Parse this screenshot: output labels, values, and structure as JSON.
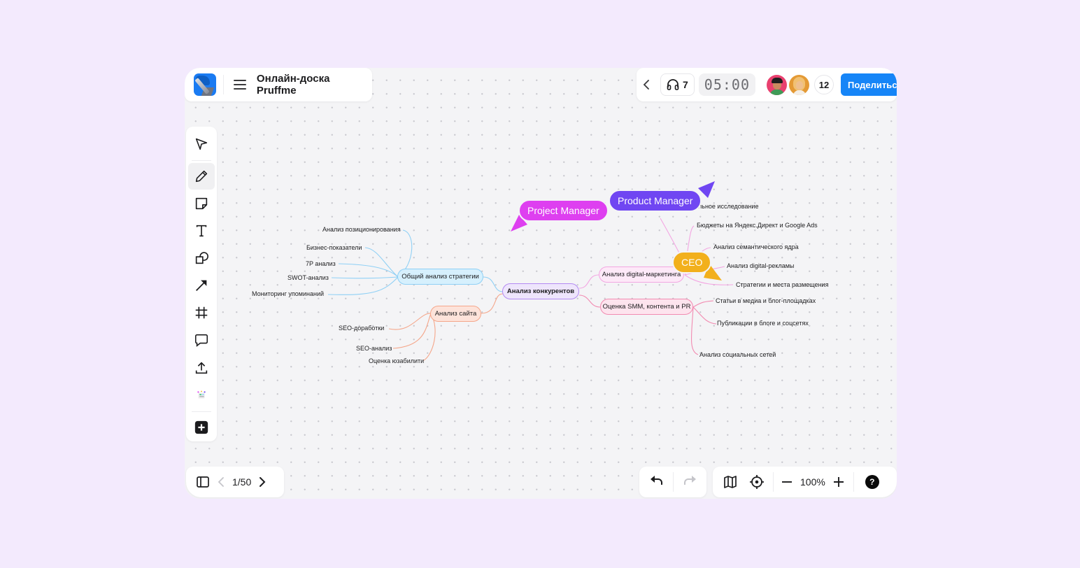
{
  "app": {
    "logo": "pruffme-logo",
    "menu_icon": "hamburger-icon",
    "title": "Онлайн-доска Pruffme"
  },
  "top_right": {
    "back_icon": "chevron-left-icon",
    "audio": {
      "icon": "headphones-icon",
      "count": "7"
    },
    "timer": "05:00",
    "participants": [
      {
        "name": "avatar-1",
        "color": "#e9406f"
      },
      {
        "name": "avatar-2",
        "color": "#e49a35"
      }
    ],
    "participants_count": "12",
    "share_label": "Поделиться",
    "share_color": "#1685f7"
  },
  "toolbar": {
    "tools": [
      {
        "name": "select",
        "icon": "cursor-arrow-icon",
        "active": false
      },
      {
        "name": "pen",
        "icon": "pencil-icon",
        "active": true
      },
      {
        "name": "sticky-note",
        "icon": "sticky-note-icon",
        "active": false
      },
      {
        "name": "text",
        "icon": "text-icon",
        "active": false
      },
      {
        "name": "shapes",
        "icon": "shapes-icon",
        "active": false
      },
      {
        "name": "arrow",
        "icon": "arrow-icon",
        "active": false
      },
      {
        "name": "frame",
        "icon": "frame-hash-icon",
        "active": false
      },
      {
        "name": "comment",
        "icon": "comment-icon",
        "active": false
      },
      {
        "name": "upload",
        "icon": "upload-icon",
        "active": false
      },
      {
        "name": "templates",
        "icon": "templates-icon",
        "active": false
      },
      {
        "name": "more",
        "icon": "plus-square-icon",
        "active": false
      }
    ]
  },
  "pagination": {
    "sidebar_icon": "sidebar-toggle-icon",
    "current": "1/50"
  },
  "history": {
    "undo_icon": "undo-icon",
    "redo_icon": "redo-icon"
  },
  "view": {
    "map_icon": "map-icon",
    "center_icon": "crosshair-icon",
    "zoom_out_icon": "minus-icon",
    "zoom": "100%",
    "zoom_in_icon": "plus-icon",
    "help_label": "?"
  },
  "mindmap": {
    "root": {
      "label": "Анализ конкурентов",
      "color": "#b38af2"
    },
    "branches": [
      {
        "label": "Общий анализ стратегии",
        "color": "#8fd0f5",
        "leaves": [
          "Анализ позиционирования",
          "Бизнес-показатели",
          "7P анализ",
          "SWOT-анализ",
          "Мониторинг упоминаний"
        ]
      },
      {
        "label": "Анализ сайта",
        "color": "#f5a68a",
        "leaves": [
          "SEO-доработки",
          "SEO-анализ",
          "Оценка юзабилити"
        ]
      },
      {
        "label": "Анализ digital-маркетинга",
        "color": "#f3a6e2",
        "leaves": [
          "...льное исследование",
          "Бюджеты на Яндекс.Директ и Google Ads",
          "Анализ семантического ядра",
          "Анализ digital-рекламы",
          "Стратегии и места размещения"
        ]
      },
      {
        "label": "Оценка SMM, контента и PR",
        "color": "#f28bb1",
        "leaves": [
          "Статьи в медиа и блог-площадках",
          "Публикации в блоге и соцсетях",
          "Анализ социальных сетей"
        ]
      }
    ],
    "partial_leaf": "льное исследование"
  },
  "cursors": [
    {
      "label": "Project Manager",
      "color": "#de3ff0"
    },
    {
      "label": "Product Manager",
      "color": "#7046f2"
    },
    {
      "label": "CEO",
      "color": "#f2b01c"
    }
  ]
}
